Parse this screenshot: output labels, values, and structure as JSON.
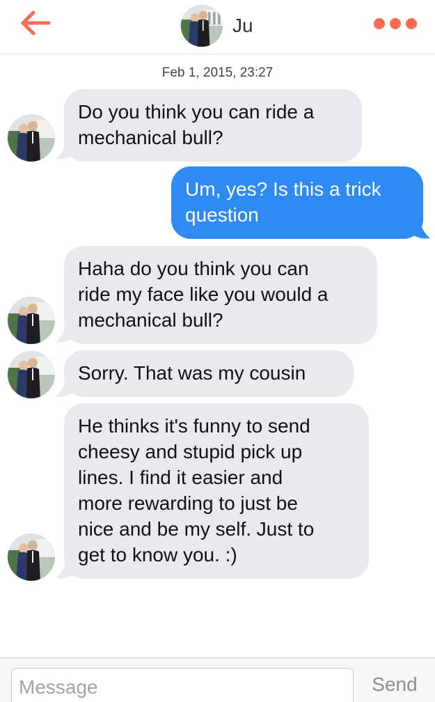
{
  "colors": {
    "accent": "#fd6b55",
    "incoming_bubble": "#e9e9ef",
    "outgoing_bubble": "#2f8af2"
  },
  "header": {
    "back_icon": "back-arrow-icon",
    "contact_name": "Ju",
    "avatar": "profile-photo",
    "more_icon": "more-dots-icon"
  },
  "conversation": {
    "timestamp": "Feb 1, 2015, 23:27",
    "messages": [
      {
        "sender": "them",
        "text": "Do you think you can ride a\nmechanical bull?"
      },
      {
        "sender": "me",
        "text": "Um, yes? Is this a trick\nquestion"
      },
      {
        "sender": "them",
        "text": "Haha do you think you can\nride my face like you would a\nmechanical bull?"
      },
      {
        "sender": "them",
        "text": "Sorry. That was my cousin"
      },
      {
        "sender": "them",
        "text": "He thinks it's funny to send\ncheesy and stupid pick up\nlines. I find it easier and\nmore rewarding to just be\nnice and be my self.  Just to\nget to know you. :)"
      }
    ]
  },
  "composer": {
    "placeholder": "Message",
    "value": "",
    "send_label": "Send"
  }
}
